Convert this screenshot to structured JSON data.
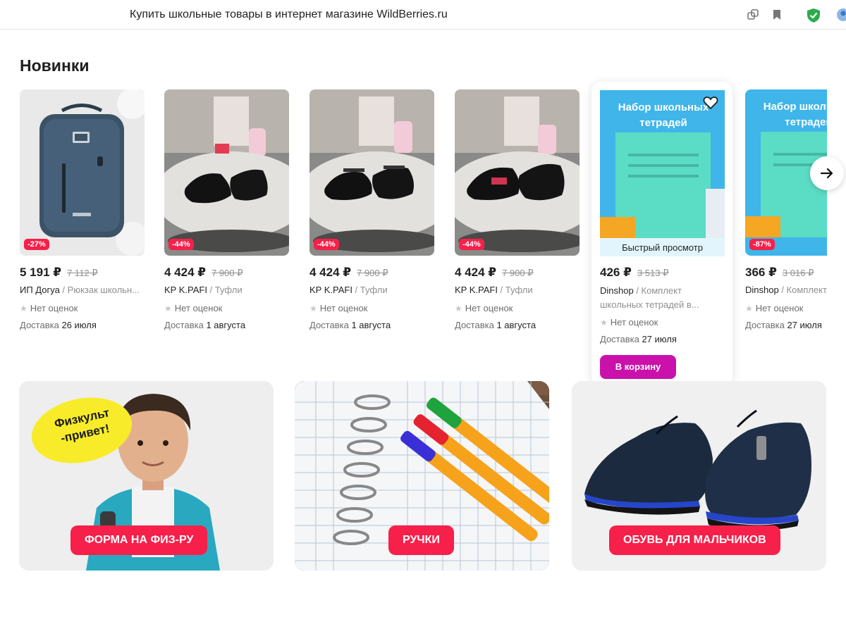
{
  "browser": {
    "page_title": "Купить школьные товары в интернет магазине WildBerries.ru"
  },
  "section": {
    "title": "Новинки"
  },
  "products": [
    {
      "badge": "-27%",
      "price": "5 191 ₽",
      "old_price": "7 112 ₽",
      "brand": "ИП Догуа",
      "category": " / Рюкзак школьн...",
      "rating": "Нет оценок",
      "delivery_label": "Доставка",
      "delivery_date": "26 июля"
    },
    {
      "badge": "-44%",
      "price": "4 424 ₽",
      "old_price": "7 900 ₽",
      "brand": "KP K.PAFI",
      "category": " / Туфли",
      "rating": "Нет оценок",
      "delivery_label": "Доставка",
      "delivery_date": "1 августа"
    },
    {
      "badge": "-44%",
      "price": "4 424 ₽",
      "old_price": "7 900 ₽",
      "brand": "KP K.PAFI",
      "category": " / Туфли",
      "rating": "Нет оценок",
      "delivery_label": "Доставка",
      "delivery_date": "1 августа"
    },
    {
      "badge": "-44%",
      "price": "4 424 ₽",
      "old_price": "7 900 ₽",
      "brand": "KP K.PAFI",
      "category": " / Туфли",
      "rating": "Нет оценок",
      "delivery_label": "Доставка",
      "delivery_date": "1 августа"
    },
    {
      "badge": "",
      "price": "426 ₽",
      "old_price": "3 513 ₽",
      "brand": "Dinshop",
      "category": " / Комплект школьных тетрадей в...",
      "rating": "Нет оценок",
      "delivery_label": "Доставка",
      "delivery_date": "27 июля",
      "quick_view": "Быстрый просмотр",
      "cart_label": "В корзину",
      "image_text": "Набор школьных тетрадей"
    },
    {
      "badge": "-87%",
      "price": "366 ₽",
      "old_price": "3 016 ₽",
      "brand": "Dinshop",
      "category": " / Комплект...",
      "rating": "Нет оценок",
      "delivery_label": "Доставка",
      "delivery_date": "27 июля",
      "image_text": "Набор школьных тетрадей"
    }
  ],
  "banners": [
    {
      "label": "ФОРМА НА ФИЗ-РУ",
      "sticker": "Физкульт -привет!"
    },
    {
      "label": "РУЧКИ"
    },
    {
      "label": "ОБУВЬ ДЛЯ МАЛЬЧИКОВ"
    }
  ],
  "colors": {
    "discount": "#f6204a",
    "cart_button": "#cb11ab",
    "banner_button": "#f6204a"
  },
  "icons": [
    "extensions-icon",
    "bookmark-icon",
    "shield-icon",
    "profile-icon",
    "heart-icon",
    "arrow-right-icon",
    "star-icon"
  ]
}
